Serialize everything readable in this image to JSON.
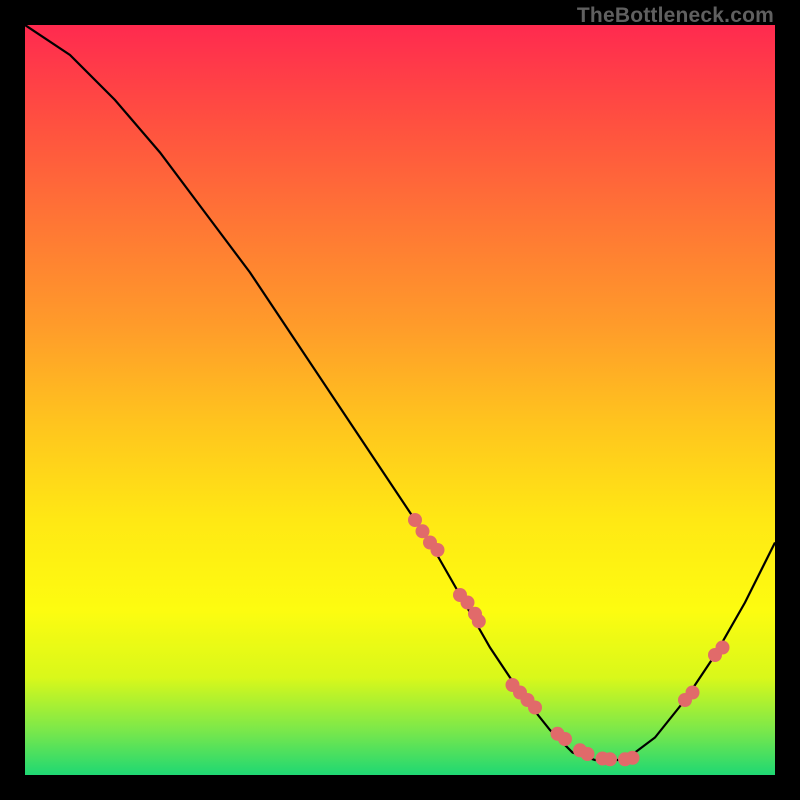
{
  "watermark": "TheBottleneck.com",
  "chart_data": {
    "type": "line",
    "title": "",
    "xlabel": "",
    "ylabel": "",
    "xlim": [
      0,
      100
    ],
    "ylim": [
      0,
      100
    ],
    "grid": false,
    "legend": false,
    "series": [
      {
        "name": "curve",
        "color": "#000000",
        "x": [
          0,
          6,
          12,
          18,
          24,
          30,
          36,
          42,
          48,
          54,
          58,
          62,
          66,
          70,
          73,
          76,
          80,
          84,
          88,
          92,
          96,
          100
        ],
        "y": [
          100,
          96,
          90,
          83,
          75,
          67,
          58,
          49,
          40,
          31,
          24,
          17,
          11,
          6,
          3,
          2,
          2,
          5,
          10,
          16,
          23,
          31
        ]
      }
    ],
    "points": {
      "name": "markers",
      "color": "#e16a6a",
      "x": [
        52,
        53,
        54,
        55,
        58,
        59,
        60,
        60.5,
        65,
        66,
        67,
        68,
        71,
        72,
        74,
        75,
        77,
        78,
        80,
        81,
        88,
        89,
        92,
        93
      ],
      "y": [
        34,
        32.5,
        31,
        30,
        24,
        23,
        21.5,
        20.5,
        12,
        11,
        10,
        9,
        5.5,
        4.8,
        3.3,
        2.8,
        2.2,
        2.1,
        2.1,
        2.3,
        10,
        11,
        16,
        17
      ]
    },
    "gradient_stops": [
      {
        "pos": 0,
        "color": "#ff2a4f"
      },
      {
        "pos": 13,
        "color": "#ff5040"
      },
      {
        "pos": 26,
        "color": "#ff7535"
      },
      {
        "pos": 40,
        "color": "#ff9b2a"
      },
      {
        "pos": 53,
        "color": "#ffc41e"
      },
      {
        "pos": 66,
        "color": "#ffe814"
      },
      {
        "pos": 78,
        "color": "#fdfc10"
      },
      {
        "pos": 87,
        "color": "#d9f81a"
      },
      {
        "pos": 94,
        "color": "#7be84a"
      },
      {
        "pos": 100,
        "color": "#1fd873"
      }
    ]
  }
}
